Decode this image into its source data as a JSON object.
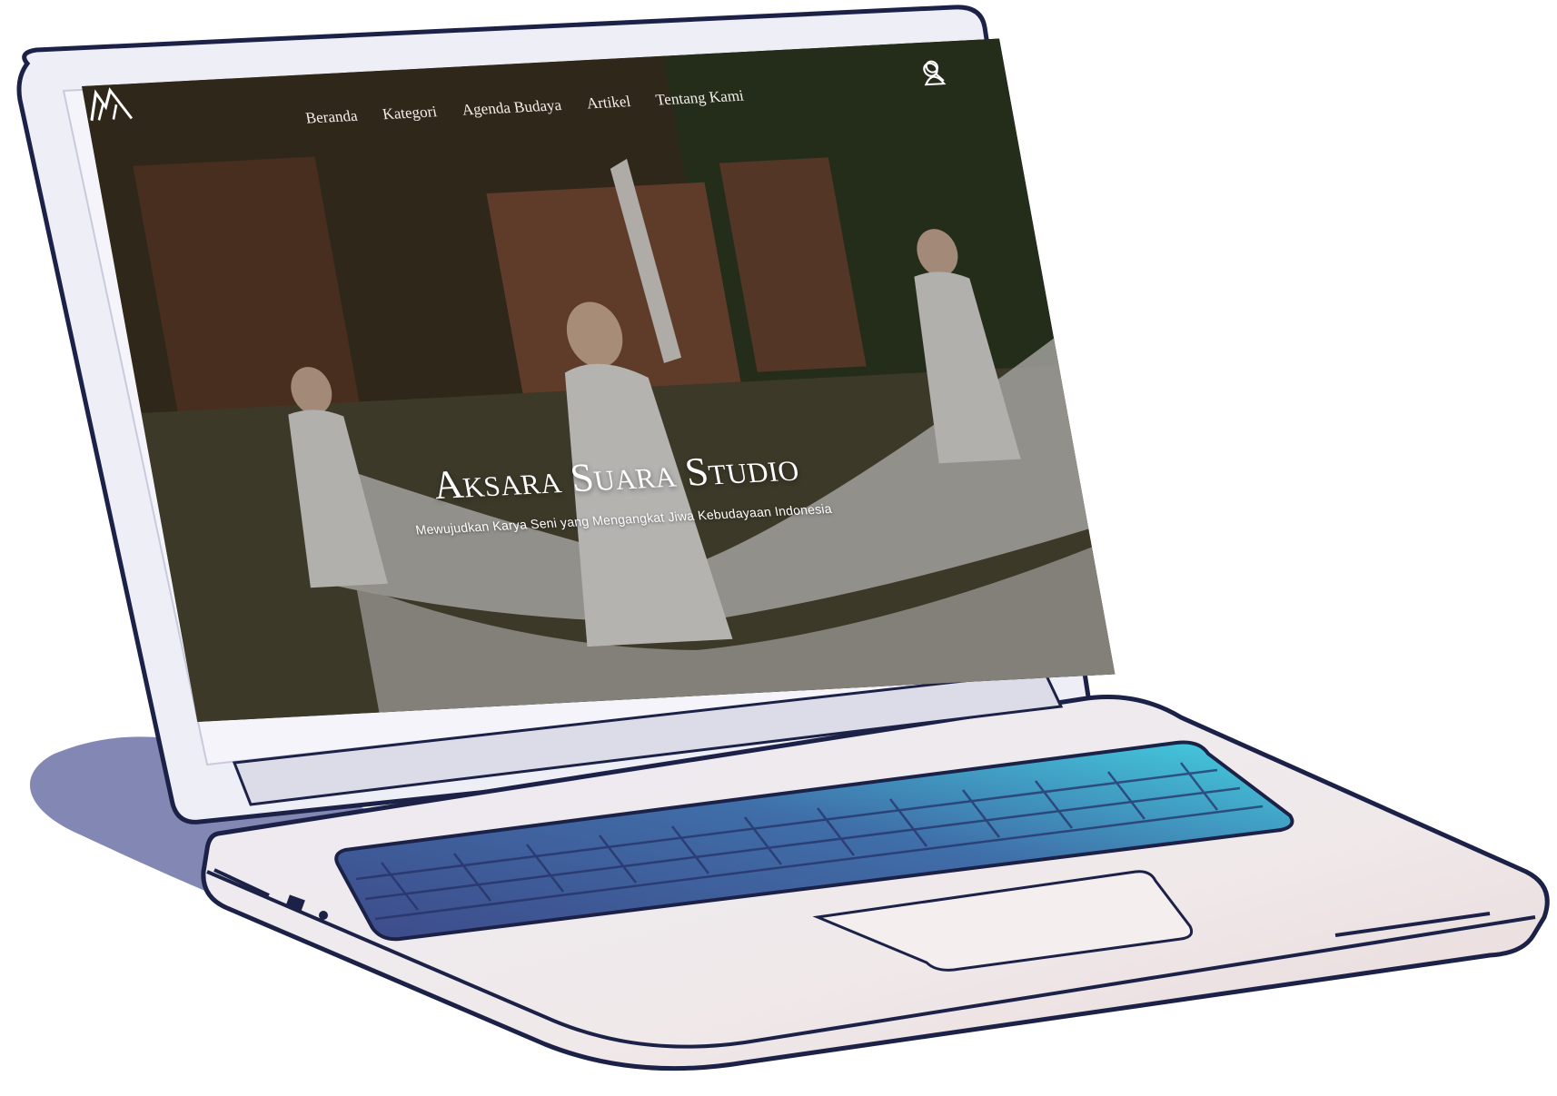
{
  "site": {
    "nav": [
      "Beranda",
      "Kategori",
      "Agenda Budaya",
      "Artikel",
      "Tentang Kami"
    ],
    "hero_title": "Aksara Suara Studio",
    "hero_subtitle": "Mewujudkan Karya Seni yang Mengangkat Jiwa Kebudayaan Indonesia",
    "logo_icon": "mountain-logo-icon",
    "search_icon": "search-icon",
    "account_icon": "user-icon"
  },
  "colors": {
    "laptop_body": "#e9e9f2",
    "laptop_outline": "#1c2147",
    "screen_bezel": "#f1f1f7",
    "keyboard_dark": "#3f4f8c",
    "keyboard_light": "#3fc7de",
    "shadow": "#6d73a6",
    "text_light": "#ffffff"
  }
}
